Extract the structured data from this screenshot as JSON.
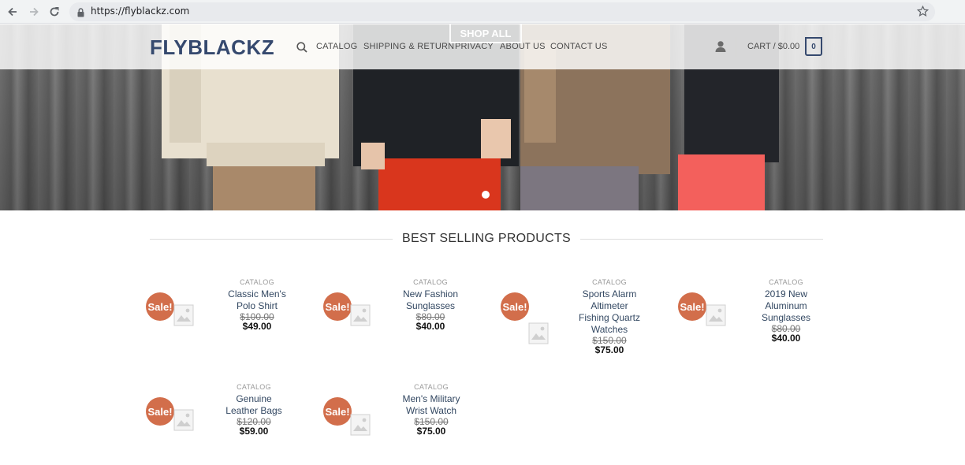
{
  "browser": {
    "url": "https://flyblackz.com"
  },
  "header": {
    "logo": "FLYBLACKZ",
    "shop_all": "SHOP ALL",
    "nav": [
      "CATALOG",
      "SHIPPING & RETURN",
      "PRIVACY",
      "ABOUT US",
      "CONTACT US"
    ],
    "cart_label": "CART / $0.00",
    "cart_count": "0"
  },
  "section": {
    "title": "BEST SELLING PRODUCTS"
  },
  "products": [
    {
      "category": "CATALOG",
      "name": "Classic Men's Polo Shirt",
      "old_price": "$100.00",
      "price": "$49.00",
      "badge": "Sale!"
    },
    {
      "category": "CATALOG",
      "name": "New Fashion Sunglasses",
      "old_price": "$80.00",
      "price": "$40.00",
      "badge": "Sale!"
    },
    {
      "category": "CATALOG",
      "name": "Sports Alarm Altimeter Fishing Quartz Watches",
      "old_price": "$150.00",
      "price": "$75.00",
      "badge": "Sale!"
    },
    {
      "category": "CATALOG",
      "name": "2019 New Aluminum Sunglasses",
      "old_price": "$80.00",
      "price": "$40.00",
      "badge": "Sale!"
    },
    {
      "category": "CATALOG",
      "name": "Genuine Leather Bags",
      "old_price": "$120.00",
      "price": "$59.00",
      "badge": "Sale!"
    },
    {
      "category": "CATALOG",
      "name": "Men's Military Wrist Watch",
      "old_price": "$150.00",
      "price": "$75.00",
      "badge": "Sale!"
    }
  ],
  "colors": {
    "brand": "#35496e",
    "sale_badge": "#d26e4b",
    "product_name": "#334862"
  },
  "icons": {
    "back": "arrow-left-icon",
    "forward": "arrow-right-icon",
    "reload": "reload-icon",
    "lock": "lock-icon",
    "bookmark": "star-icon",
    "search": "search-icon",
    "account": "user-icon",
    "product_image": "image-placeholder-icon"
  },
  "hero": {
    "active_slide": 1,
    "slide_count": 1
  }
}
